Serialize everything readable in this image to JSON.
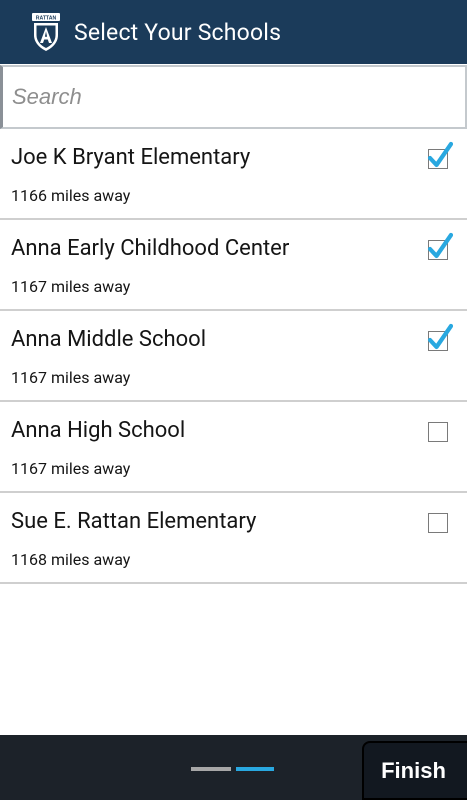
{
  "header": {
    "logo_text": "RATTAN",
    "title": "Select Your Schools"
  },
  "search": {
    "placeholder": "Search",
    "value": ""
  },
  "schools": [
    {
      "name": "Joe K Bryant Elementary",
      "distance": "1166 miles away",
      "checked": true
    },
    {
      "name": "Anna Early Childhood Center",
      "distance": "1167 miles away",
      "checked": true
    },
    {
      "name": "Anna Middle School",
      "distance": "1167 miles away",
      "checked": true
    },
    {
      "name": "Anna High School",
      "distance": "1167 miles away",
      "checked": false
    },
    {
      "name": "Sue E. Rattan Elementary",
      "distance": "1168 miles away",
      "checked": false
    }
  ],
  "footer": {
    "finish_label": "Finish",
    "page_indicator": {
      "total": 2,
      "current": 2
    }
  },
  "colors": {
    "header_bg": "#1b3b5a",
    "footer_bg": "#1c2229",
    "check_accent": "#29a8e0",
    "pager_active": "#29a8e0",
    "pager_inactive": "#a7a7a7"
  },
  "icons": {
    "logo": "rattan-shield-logo-icon",
    "checkbox_checked": "checkmark-icon"
  }
}
